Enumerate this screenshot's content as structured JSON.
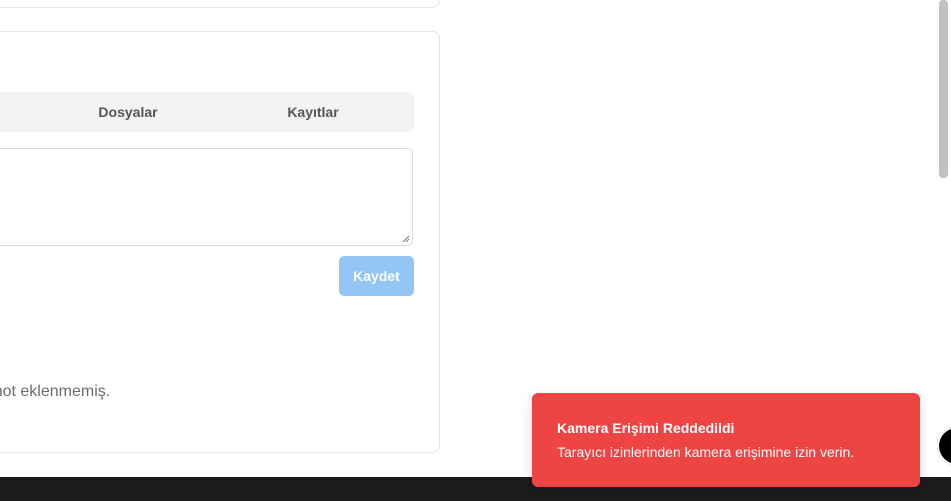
{
  "tabs": {
    "files_label": "Dosyalar",
    "records_label": "Kayıtlar"
  },
  "notes": {
    "input_value": "",
    "save_label": "Kaydet",
    "empty_message": "Henüz not eklenmemiş."
  },
  "toast": {
    "title": "Kamera Erişimi Reddedildi",
    "message": "Tarayıcı izinlerinden kamera erişimine izin verin.",
    "color": "#ef4444"
  },
  "colors": {
    "save_button": "#93c5f5",
    "footer": "#1c1c1c",
    "tab_bar": "#f4f3f1"
  }
}
